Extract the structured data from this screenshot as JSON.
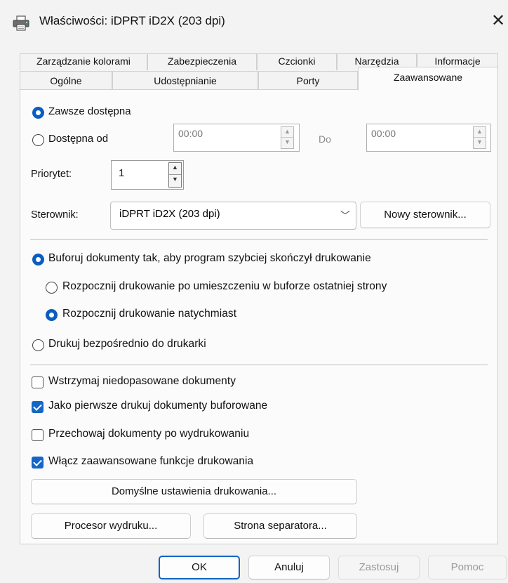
{
  "window": {
    "title": "Właściwości: iDPRT iD2X (203 dpi)",
    "close_glyph": "✕"
  },
  "tabs": {
    "row1": [
      "Zarządzanie kolorami",
      "Zabezpieczenia",
      "Czcionki",
      "Narzędzia",
      "Informacje"
    ],
    "row2": [
      "Ogólne",
      "Udostępnianie",
      "Porty",
      "Zaawansowane"
    ],
    "active": "Zaawansowane"
  },
  "availability": {
    "always_label": "Zawsze dostępna",
    "from_label": "Dostępna od",
    "from_time": "00:00",
    "to_label": "Do",
    "to_time": "00:00",
    "selected": "always"
  },
  "priority": {
    "label": "Priorytet:",
    "value": "1"
  },
  "driver": {
    "label": "Sterownik:",
    "value": "iDPRT iD2X (203 dpi)",
    "new_button": "Nowy sterownik..."
  },
  "spooling": {
    "spool_label": "Buforuj dokumenty tak, aby program szybciej skończył drukowanie",
    "after_last_page_label": "Rozpocznij drukowanie po umieszczeniu w buforze ostatniej strony",
    "immediately_label": "Rozpocznij drukowanie natychmiast",
    "direct_label": "Drukuj bezpośrednio do drukarki",
    "selected_mode": "spool",
    "selected_start": "immediately"
  },
  "options": [
    {
      "label": "Wstrzymaj niedopasowane dokumenty",
      "checked": false
    },
    {
      "label": "Jako pierwsze drukuj dokumenty buforowane",
      "checked": true
    },
    {
      "label": "Przechowaj dokumenty po wydrukowaniu",
      "checked": false
    },
    {
      "label": "Włącz zaawansowane funkcje drukowania",
      "checked": true
    }
  ],
  "buttons": {
    "defaults": "Domyślne ustawienia drukowania...",
    "processor": "Procesor wydruku...",
    "separator": "Strona separatora...",
    "ok": "OK",
    "cancel": "Anuluj",
    "apply": "Zastosuj",
    "help": "Pomoc"
  },
  "colors": {
    "accent": "#1366c5",
    "background": "#f3f3f3",
    "panel": "#fbfbfb"
  }
}
